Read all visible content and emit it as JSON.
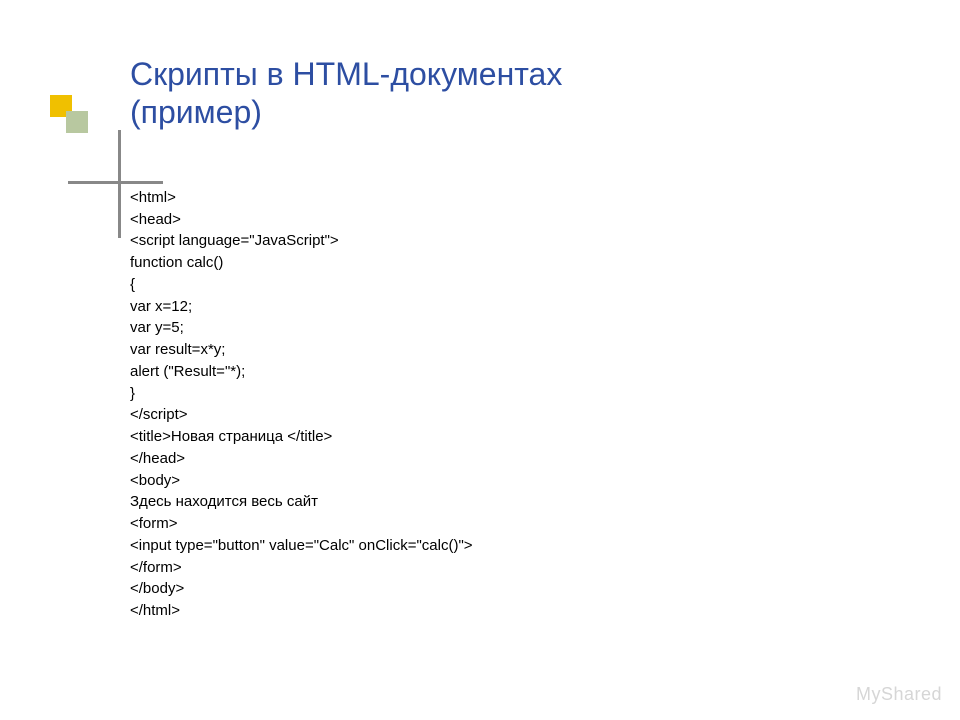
{
  "title": {
    "line1": "Скрипты в HTML-документах",
    "line2": "(пример)"
  },
  "code": {
    "lines": [
      "<html>",
      "<head>",
      "<script language=\"JavaScript\">",
      "function calc()",
      "{",
      "var x=12;",
      "var y=5;",
      "var result=x*y;",
      "alert (\"Result=\"*);",
      "}",
      "</script>",
      "<title>Новая страница </title>",
      "</head>",
      "<body>",
      "Здесь находится весь сайт",
      "<form>",
      "<input type=\"button\" value=\"Calc\" onClick=\"calc()\">",
      "</form>",
      "</body>",
      "</html>"
    ]
  },
  "watermark": "MyShared"
}
